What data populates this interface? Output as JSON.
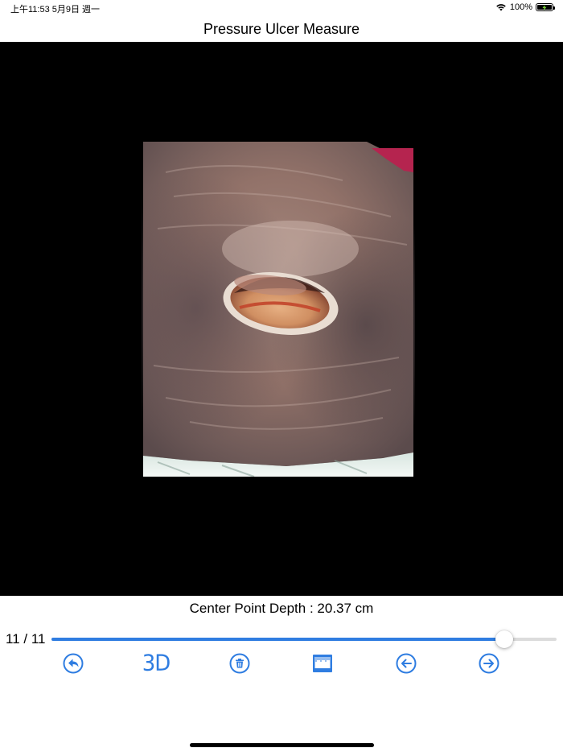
{
  "status_bar": {
    "time_date": "上午11:53   5月9日 週一",
    "battery": "100%"
  },
  "nav": {
    "title": "Pressure Ulcer Measure"
  },
  "viewer": {
    "image": "pressure-ulcer-wound-photo"
  },
  "measurement": {
    "depth_label": "Center Point Depth : 20.37 cm"
  },
  "navigation": {
    "counter": "11 / 11",
    "current": 11,
    "total": 11,
    "slider_fraction": 0.897
  },
  "toolbar": {
    "back_icon": "reply-arrow-icon",
    "three_d_label": "3D",
    "delete_icon": "trash-icon",
    "ruler_icon": "ruler-icon",
    "prev_icon": "arrow-left-circle-icon",
    "next_icon": "arrow-right-circle-icon"
  },
  "colors": {
    "accent": "#2f7de1",
    "viewer_background": "#000000"
  }
}
